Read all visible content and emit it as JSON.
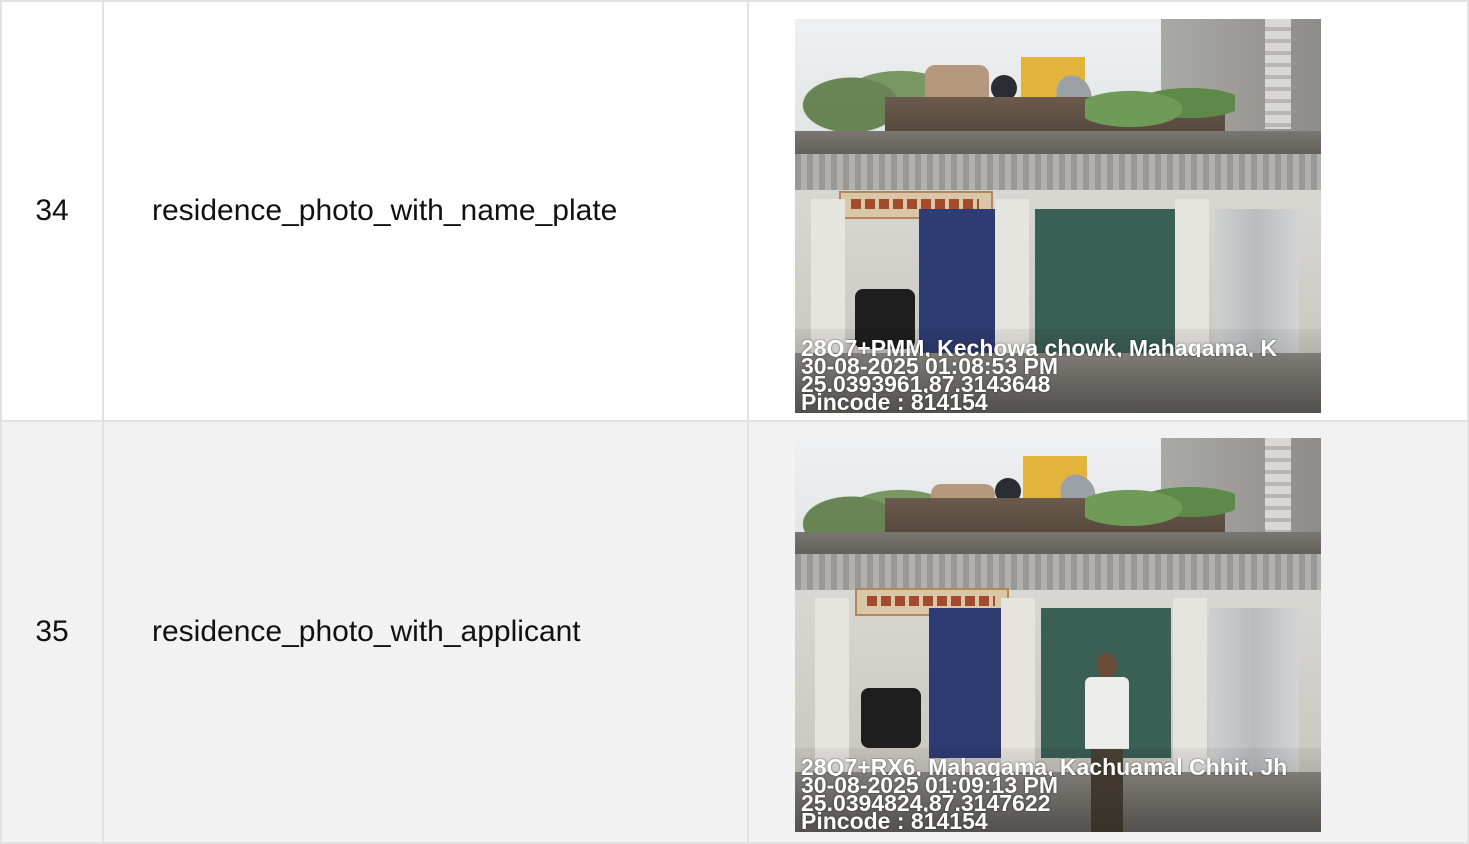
{
  "rows": [
    {
      "number": "34",
      "field": "residence_photo_with_name_plate",
      "photo": {
        "overlay": [
          "28Q7+PMM, Kechowa chowk, Mahagama, K",
          "30-08-2025 01:08:53 PM",
          "25.0393961,87.3143648",
          "Pincode : 814154"
        ]
      }
    },
    {
      "number": "35",
      "field": "residence_photo_with_applicant",
      "photo": {
        "overlay": [
          "28Q7+RX6, Mahagama, Kachuamal Chhit, Jh",
          "30-08-2025 01:09:13 PM",
          "25.0394824,87.3147622",
          "Pincode : 814154"
        ]
      }
    }
  ]
}
